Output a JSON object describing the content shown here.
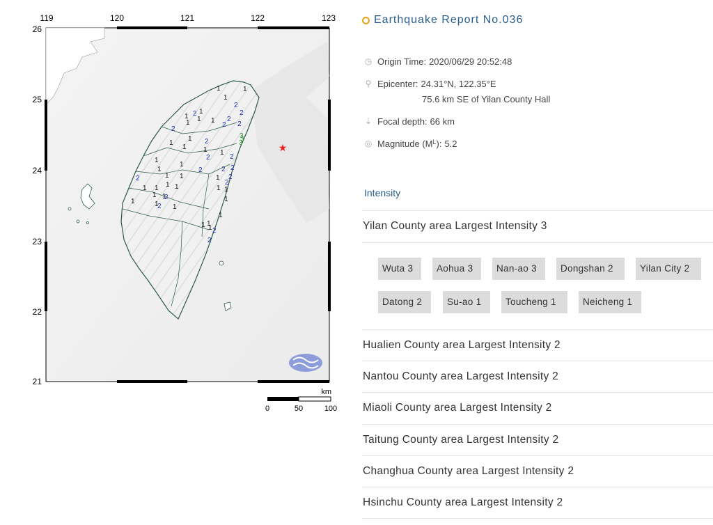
{
  "map": {
    "lon_ticks": [
      "119",
      "120",
      "121",
      "122",
      "123"
    ],
    "lat_ticks": [
      "26",
      "25",
      "24",
      "23",
      "22",
      "21"
    ],
    "scale_unit": "km",
    "scale_labels": [
      "0",
      "50",
      "100"
    ],
    "epicenter_color": "#e8201a",
    "station_intensities": [
      "1",
      "2",
      "1",
      "1",
      "2",
      "1",
      "1",
      "1",
      "2",
      "1",
      "1",
      "2",
      "2",
      "2",
      "2",
      "1",
      "1",
      "2",
      "1",
      "1",
      "2",
      "1",
      "1",
      "1",
      "1",
      "2",
      "2",
      "1",
      "2",
      "1",
      "1",
      "1",
      "1",
      "1",
      "2",
      "2",
      "1",
      "1",
      "1",
      "2",
      "1",
      "2",
      "1",
      "1",
      "1",
      "1",
      "2",
      "2",
      "1",
      "3",
      "3",
      "3",
      "1",
      "2",
      "1",
      "1",
      "2",
      "1"
    ]
  },
  "report": {
    "title": "Earthquake Report No.036",
    "origin_time_label": "Origin Time:",
    "origin_time": "2020/06/29 20:52:48",
    "epicenter_label": "Epicenter:",
    "epicenter": "24.31°N, 122.35°E",
    "epicenter_desc": "75.6 km SE of Yilan County Hall",
    "focal_depth_label": "Focal depth:",
    "focal_depth": "66 km",
    "magnitude_label": "Magnitude (M",
    "magnitude_sub": "L",
    "magnitude_suffix": "):",
    "magnitude": "5.2"
  },
  "intensity": {
    "section_title": "Intensity",
    "areas": [
      "Yilan County area Largest Intensity 3",
      "Hualien County area Largest Intensity 2",
      "Nantou County area Largest Intensity 2",
      "Miaoli County area Largest Intensity 2",
      "Taitung County area Largest Intensity 2",
      "Changhua County area Largest Intensity 2",
      "Hsinchu County area Largest Intensity 2"
    ],
    "yilan_stations": [
      "Wuta 3",
      "Aohua 3",
      "Nan-ao 3",
      "Dongshan 2",
      "Yilan City 2",
      "Datong 2",
      "Su-ao 1",
      "Toucheng 1",
      "Neicheng 1"
    ]
  }
}
